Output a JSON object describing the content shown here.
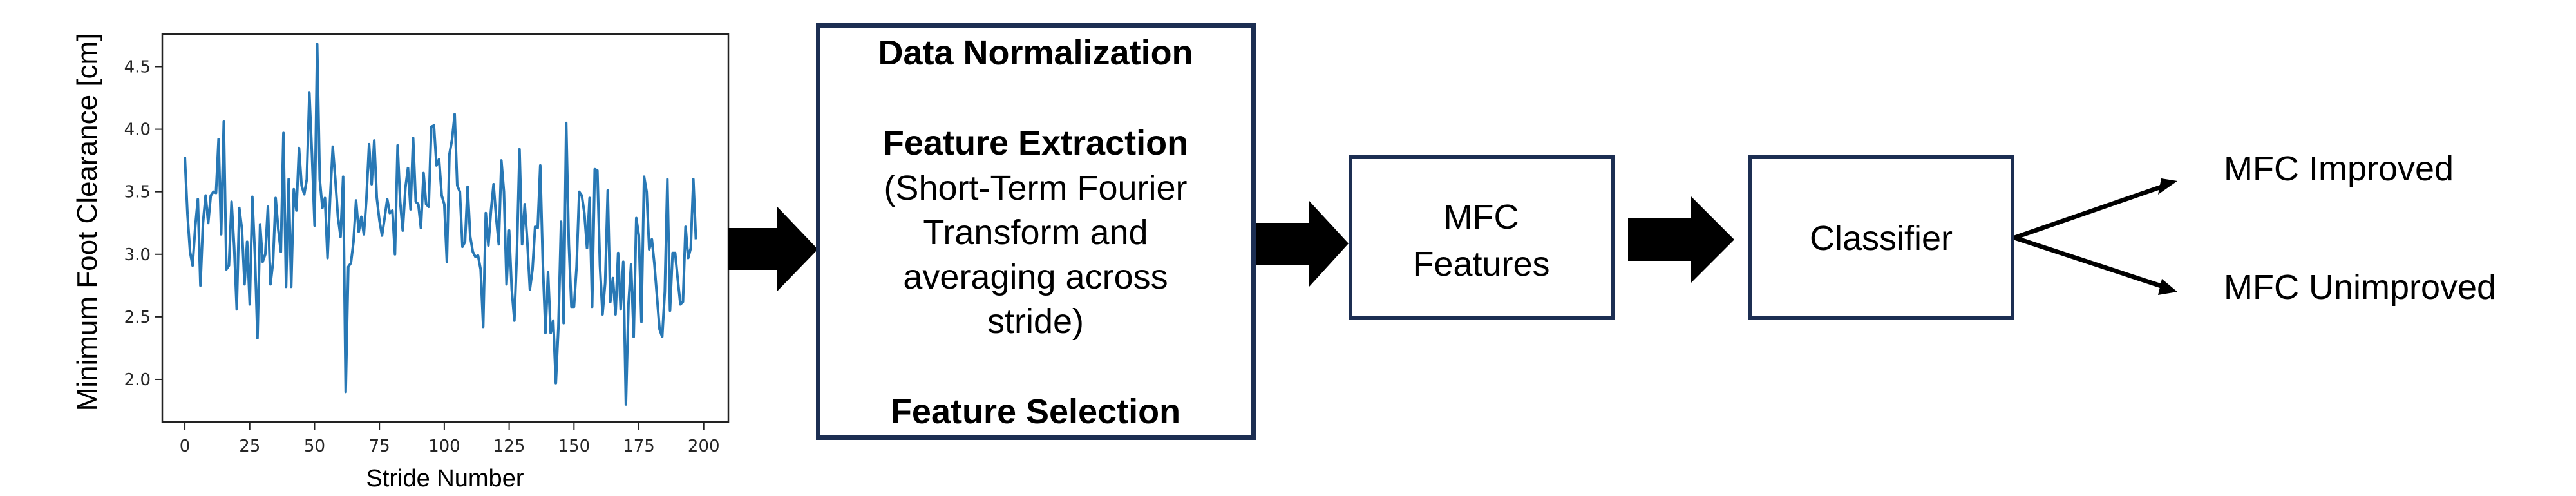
{
  "chart_data": {
    "type": "line",
    "title": "",
    "xlabel": "Stride Number",
    "ylabel": "Minimum Foot Clearance [cm]",
    "xlim": [
      -8.7,
      209.5
    ],
    "ylim": [
      1.66,
      4.76
    ],
    "xticks": [
      0,
      25,
      50,
      75,
      100,
      125,
      150,
      175,
      200
    ],
    "xtick_labels": [
      "0",
      "25",
      "50",
      "75",
      "100",
      "125",
      "150",
      "175",
      "200"
    ],
    "yticks": [
      2.0,
      2.5,
      3.0,
      3.5,
      4.0,
      4.5
    ],
    "ytick_labels": [
      "2.0",
      "2.5",
      "3.0",
      "3.5",
      "4.0",
      "4.5"
    ],
    "grid": false,
    "legend": "none",
    "series": [
      {
        "name": "MFC",
        "color": "#2878b5",
        "approximate": true,
        "x_start": 0,
        "x_step": 1,
        "values": [
          3.78,
          3.32,
          3.02,
          2.91,
          3.22,
          3.44,
          2.75,
          3.25,
          3.47,
          3.25,
          3.47,
          3.5,
          3.49,
          3.92,
          3.16,
          4.06,
          2.88,
          2.91,
          3.42,
          3.06,
          2.56,
          3.37,
          3.2,
          2.76,
          3.1,
          2.6,
          3.46,
          3.0,
          2.33,
          3.24,
          2.94,
          3.0,
          3.38,
          2.76,
          2.94,
          3.45,
          3.2,
          3.02,
          3.97,
          2.74,
          3.6,
          2.74,
          3.52,
          3.35,
          3.85,
          3.55,
          3.48,
          3.6,
          4.29,
          3.8,
          3.23,
          4.68,
          3.6,
          3.37,
          3.45,
          2.97,
          3.45,
          3.86,
          3.6,
          3.3,
          3.14,
          3.62,
          1.9,
          2.9,
          2.93,
          3.1,
          3.43,
          3.18,
          3.3,
          3.16,
          3.45,
          3.88,
          3.56,
          3.91,
          3.45,
          3.27,
          3.15,
          3.29,
          3.44,
          3.33,
          3.35,
          3.0,
          3.87,
          3.42,
          3.19,
          3.53,
          3.69,
          3.36,
          3.93,
          3.42,
          3.4,
          3.21,
          3.65,
          3.4,
          3.38,
          4.02,
          4.03,
          3.71,
          3.76,
          3.47,
          3.4,
          2.94,
          3.8,
          3.92,
          4.12,
          3.55,
          3.5,
          3.06,
          3.1,
          3.54,
          3.14,
          3.02,
          2.98,
          2.99,
          2.88,
          2.42,
          3.33,
          3.07,
          3.35,
          3.56,
          3.29,
          3.08,
          3.75,
          3.5,
          2.76,
          3.19,
          2.72,
          2.47,
          3.02,
          3.84,
          3.08,
          3.4,
          3.1,
          2.72,
          2.88,
          3.22,
          3.21,
          3.71,
          2.91,
          2.37,
          2.86,
          2.37,
          2.47,
          1.97,
          2.42,
          3.26,
          2.45,
          4.05,
          3.08,
          2.58,
          2.58,
          2.9,
          3.5,
          3.47,
          3.33,
          3.05,
          3.45,
          2.58,
          3.68,
          3.67,
          2.91,
          2.52,
          2.77,
          3.51,
          2.62,
          2.81,
          2.52,
          3.01,
          2.56,
          2.94,
          1.8,
          2.6,
          2.92,
          2.34,
          3.29,
          3.15,
          2.46,
          3.62,
          3.5,
          3.04,
          3.12,
          2.92,
          2.66,
          2.4,
          2.34,
          2.7,
          3.6,
          2.55,
          3.01,
          3.01,
          2.8,
          2.6,
          2.62,
          3.22,
          2.97,
          3.05,
          3.6,
          3.12
        ]
      }
    ]
  },
  "diagram": {
    "processing_box": {
      "heading_1": "Data Normalization",
      "heading_2": "Feature Extraction",
      "description_lines": [
        "(Short-Term Fourier",
        "Transform and",
        "averaging across",
        "stride)"
      ],
      "heading_3": "Feature Selection"
    },
    "features_box": {
      "lines": [
        "MFC",
        "Features"
      ]
    },
    "classifier_box": {
      "label": "Classifier"
    },
    "outputs": {
      "improved": "MFC Improved",
      "unimproved": "MFC Unimproved"
    },
    "colors": {
      "box_border": "#1c2e52",
      "arrow": "#000000",
      "line": "#2878b5"
    }
  }
}
